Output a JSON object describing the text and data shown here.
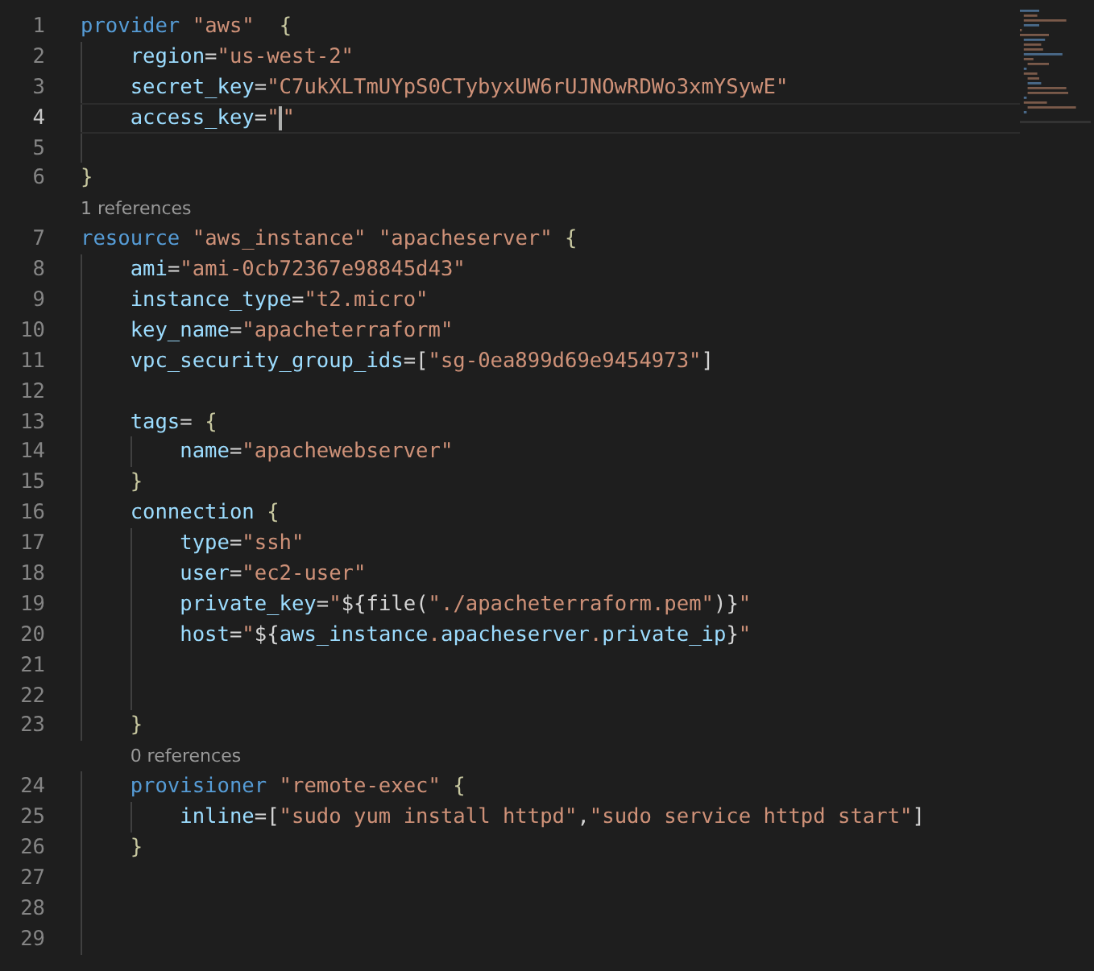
{
  "editor": {
    "lines": [
      {
        "kind": "code",
        "number": "1",
        "current": false,
        "text": "provider \"aws\"  {"
      },
      {
        "kind": "code",
        "number": "2",
        "current": false,
        "text": "    region=\"us-west-2\""
      },
      {
        "kind": "code",
        "number": "3",
        "current": false,
        "text": "    secret_key=\"C7ukXLTmUYpS0CTybyxUW6rUJNOwRDWo3xmYSywE\""
      },
      {
        "kind": "code",
        "number": "4",
        "current": true,
        "text": "    access_key=\"",
        "text_after_cursor": "\""
      },
      {
        "kind": "blank",
        "number": "5",
        "current": false
      },
      {
        "kind": "code",
        "number": "6",
        "current": false,
        "text": "}"
      },
      {
        "kind": "codelens",
        "text": "1 references"
      },
      {
        "kind": "code",
        "number": "7",
        "current": false,
        "text": "resource \"aws_instance\" \"apacheserver\" {"
      },
      {
        "kind": "code",
        "number": "8",
        "current": false,
        "text": "    ami=\"ami-0cb72367e98845d43\""
      },
      {
        "kind": "code",
        "number": "9",
        "current": false,
        "text": "    instance_type=\"t2.micro\""
      },
      {
        "kind": "code",
        "number": "10",
        "current": false,
        "text": "    key_name=\"apacheterraform\""
      },
      {
        "kind": "code",
        "number": "11",
        "current": false,
        "text": "    vpc_security_group_ids=[\"sg-0ea899d69e9454973\"]"
      },
      {
        "kind": "blank",
        "number": "12",
        "current": false
      },
      {
        "kind": "code",
        "number": "13",
        "current": false,
        "text": "    tags= {"
      },
      {
        "kind": "code",
        "number": "14",
        "current": false,
        "text": "        name=\"apachewebserver\""
      },
      {
        "kind": "code",
        "number": "15",
        "current": false,
        "text": "    }"
      },
      {
        "kind": "code",
        "number": "16",
        "current": false,
        "text": "    connection {"
      },
      {
        "kind": "code",
        "number": "17",
        "current": false,
        "text": "        type=\"ssh\""
      },
      {
        "kind": "code",
        "number": "18",
        "current": false,
        "text": "        user=\"ec2-user\""
      },
      {
        "kind": "code",
        "number": "19",
        "current": false,
        "text": "        private_key=\"${file(\"./apacheterraform.pem\")}\""
      },
      {
        "kind": "code",
        "number": "20",
        "current": false,
        "text": "        host=\"${aws_instance.apacheserver.private_ip}\""
      },
      {
        "kind": "blank",
        "number": "21",
        "current": false
      },
      {
        "kind": "blank",
        "number": "22",
        "current": false
      },
      {
        "kind": "code",
        "number": "23",
        "current": false,
        "text": "    }"
      },
      {
        "kind": "codelens",
        "text": "0 references"
      },
      {
        "kind": "code",
        "number": "24",
        "current": false,
        "text": "    provisioner \"remote-exec\" {"
      },
      {
        "kind": "code",
        "number": "25",
        "current": false,
        "text": "        inline=[\"sudo yum install httpd\",\"sudo service httpd start\"]"
      },
      {
        "kind": "code",
        "number": "26",
        "current": false,
        "text": "    }"
      },
      {
        "kind": "blank",
        "number": "27",
        "current": false
      },
      {
        "kind": "blank",
        "number": "28",
        "current": false
      },
      {
        "kind": "blank",
        "number": "29",
        "current": false
      }
    ]
  }
}
